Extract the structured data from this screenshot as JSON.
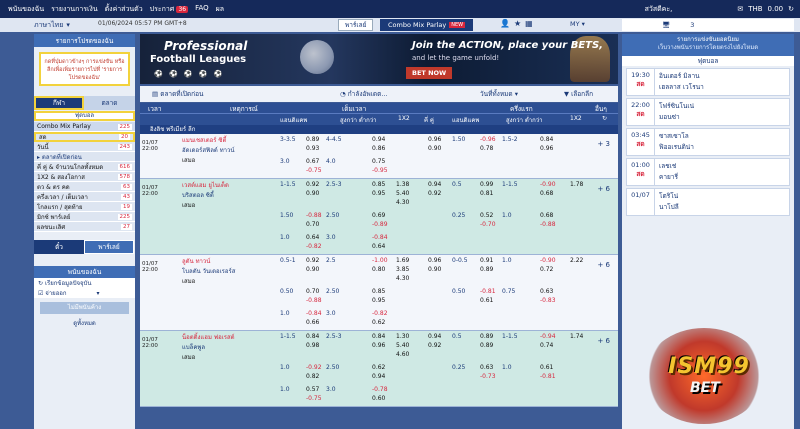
{
  "topbar": {
    "menu": [
      "พนันของฉัน",
      "รายงานการเงิน",
      "ตั้งค่าส่วนตัว",
      "ประกาศ",
      "FAQ",
      "ผล"
    ],
    "notice_count": "36",
    "greeting": "สวัสดีคะ,",
    "currency": "THB",
    "balance": "0.00"
  },
  "secondbar": {
    "language": "ภาษาไทย",
    "datetime": "01/06/2024 05:57 PM GMT+8",
    "tab_party": "พาร์เลย์",
    "tab_combo": "Combo Mix Parlay",
    "tab_new": "NEW",
    "my_label": "MY",
    "right_count": "3"
  },
  "left": {
    "header": "รายการโปรดของฉัน",
    "favorites_hint": "กดที่ปุ่มดาวข้างๆ การแข่งขัน หรือลีกเพื่อเพิ่มรายการไปที่ 'รายการโปรดของฉัน'",
    "tab_sports": "กีฬา",
    "tab_market": "ตลาด",
    "sub_soccer": "ฟุตบอล",
    "items": [
      {
        "label": "Combo Mix Parlay",
        "count": "225"
      },
      {
        "label": "สด",
        "count": "20"
      },
      {
        "label": "วันนี้",
        "count": "243"
      },
      {
        "label": "▸ ตลาดที่เปิดก่อน",
        "count": ""
      },
      {
        "label": "คี่ คู่ & จำนวนโกลทั้งหมด",
        "count": "616"
      },
      {
        "label": "1X2 & สองโอกาส",
        "count": "578"
      },
      {
        "label": "ตว & ตร คด",
        "count": "63"
      },
      {
        "label": "ครึ่งเวลา / เต็มเวลา",
        "count": "43"
      },
      {
        "label": "โกลแรก / สุดท้าย",
        "count": "19"
      },
      {
        "label": "มิกซ์ พาร์เลย์",
        "count": "225"
      },
      {
        "label": "ผลขนะเลิศ",
        "count": "27"
      }
    ],
    "btab_ticket": "ตั๋ว",
    "btab_parlay": "พาร์เลย์",
    "my_bets": "พนันของฉัน",
    "refresh": "เรียกข้อมูลปัจจุบัน",
    "pending": "รอการยืนยัน",
    "rejected": "จ่ายออก",
    "no_bets": "ไม่มีพนันค้าง",
    "view_all": "ดูทั้งหมด"
  },
  "banner": {
    "title1": "Professional",
    "title2": "Football Leagues",
    "title3": "Join the ACTION, place your BETS,",
    "title4": "and let the game unfold!",
    "cta": "BET NOW"
  },
  "filter": {
    "pre_market": "ตลาดที่เปิดก่อน",
    "updating": "กำลังอัพเดต...",
    "all_days": "วันที่ทั้งหมด",
    "select_league": "เลือกลีก"
  },
  "grid": {
    "h_time": "เวลา",
    "h_event": "เหตุการณ์",
    "h_full": "เต็มเวลา",
    "h_half": "ครึ่งแรก",
    "h_more": "อื่นๆ",
    "h_hdp": "แฮนดิแคพ",
    "h_ou": "สูงกว่า ต่ำกว่า",
    "h_1x2": "1X2",
    "h_oe": "คี่ คู่",
    "h_hdp2": "แฮนดิแคพ",
    "h_ou2": "สูงกว่า ต่ำกว่า",
    "h_1x22": "1X2",
    "league": "อิงลิช พรีเมียร์ ลีก"
  },
  "matches": [
    {
      "date": "01/07",
      "time": "22:00",
      "home": "แมนเชสเตอร์ ซิตี้",
      "away": "ฮัดเดอร์สฟิลด์ ทาวน์",
      "draw": "เสมอ",
      "more": "+ 3",
      "style": "white",
      "rows": [
        {
          "h": "3-3.5",
          "hv1": "0.89",
          "hv2": "0.93",
          "ou": "4-4.5",
          "ov1": "0.94",
          "ov2": "0.86",
          "x1": "",
          "x2": "",
          "x3": "",
          "oe1": "0.96",
          "oe2": "0.90",
          "hh": "1.50",
          "hh1": "-0.96",
          "hh2": "0.78",
          "ho": "1.5-2",
          "ho1": "0.84",
          "ho2": "0.96",
          "hx": ""
        },
        {
          "h": "3.0",
          "hv1": "0.67",
          "hv2": "-0.75",
          "ou": "4.0",
          "ov1": "0.75",
          "ov2": "-0.95",
          "x1": "",
          "x2": "",
          "x3": "",
          "oe1": "",
          "oe2": "",
          "hh": "",
          "hh1": "",
          "hh2": "",
          "ho": "",
          "ho1": "",
          "ho2": "",
          "hx": ""
        }
      ]
    },
    {
      "date": "01/07",
      "time": "22:00",
      "home": "เวสต์แฮม ยูไนเต็ด",
      "away": "บริสตอล ซิตี้",
      "draw": "เสมอ",
      "more": "+ 6",
      "style": "green",
      "rows": [
        {
          "h": "1-1.5",
          "hv1": "0.92",
          "hv2": "0.90",
          "ou": "2.5-3",
          "ov1": "0.85",
          "ov2": "0.95",
          "x1": "1.38",
          "x2": "5.40",
          "x3": "4.30",
          "oe1": "0.94",
          "oe2": "0.92",
          "hh": "0.5",
          "hh1": "0.99",
          "hh2": "0.81",
          "ho": "1-1.5",
          "ho1": "-0.90",
          "ho2": "0.68",
          "hx": "1.78"
        },
        {
          "h": "1.50",
          "hv1": "-0.88",
          "hv2": "0.70",
          "ou": "2.50",
          "ov1": "0.69",
          "ov2": "-0.89",
          "x1": "",
          "x2": "",
          "x3": "",
          "oe1": "",
          "oe2": "",
          "hh": "0.25",
          "hh1": "0.52",
          "hh2": "-0.70",
          "ho": "1.0",
          "ho1": "0.68",
          "ho2": "-0.88",
          "hx": ""
        },
        {
          "h": "1.0",
          "hv1": "0.64",
          "hv2": "-0.82",
          "ou": "3.0",
          "ov1": "-0.84",
          "ov2": "0.64",
          "x1": "",
          "x2": "",
          "x3": "",
          "oe1": "",
          "oe2": "",
          "hh": "",
          "hh1": "",
          "hh2": "",
          "ho": "",
          "ho1": "",
          "ho2": "",
          "hx": ""
        }
      ]
    },
    {
      "date": "01/07",
      "time": "22:00",
      "home": "ลูตัน ทาวน์",
      "away": "โบลตัน วันเดอเรอร์ส",
      "draw": "เสมอ",
      "more": "+ 6",
      "style": "white",
      "rows": [
        {
          "h": "0.5-1",
          "hv1": "0.92",
          "hv2": "0.90",
          "ou": "2.5",
          "ov1": "-1.00",
          "ov2": "0.80",
          "x1": "1.69",
          "x2": "3.85",
          "x3": "4.30",
          "oe1": "0.96",
          "oe2": "0.90",
          "hh": "0-0.5",
          "hh1": "0.91",
          "hh2": "0.89",
          "ho": "1.0",
          "ho1": "-0.90",
          "ho2": "0.72",
          "hx": "2.22"
        },
        {
          "h": "0.50",
          "hv1": "0.70",
          "hv2": "-0.88",
          "ou": "2.50",
          "ov1": "0.85",
          "ov2": "0.95",
          "x1": "",
          "x2": "",
          "x3": "",
          "oe1": "",
          "oe2": "",
          "hh": "0.50",
          "hh1": "-0.81",
          "hh2": "0.61",
          "ho": "0.75",
          "ho1": "0.63",
          "ho2": "-0.83",
          "hx": ""
        },
        {
          "h": "1.0",
          "hv1": "-0.84",
          "hv2": "0.66",
          "ou": "3.0",
          "ov1": "-0.82",
          "ov2": "0.62",
          "x1": "",
          "x2": "",
          "x3": "",
          "oe1": "",
          "oe2": "",
          "hh": "",
          "hh1": "",
          "hh2": "",
          "ho": "",
          "ho1": "",
          "ho2": "",
          "hx": ""
        }
      ]
    },
    {
      "date": "01/07",
      "time": "22:00",
      "home": "น็อตติ้งแฮม ฟอเรสต์",
      "away": "แบล็คพูล",
      "draw": "เสมอ",
      "more": "+ 6",
      "style": "green",
      "rows": [
        {
          "h": "1-1.5",
          "hv1": "0.84",
          "hv2": "0.98",
          "ou": "2.5-3",
          "ov1": "0.84",
          "ov2": "0.96",
          "x1": "1.30",
          "x2": "5.40",
          "x3": "4.60",
          "oe1": "0.94",
          "oe2": "0.92",
          "hh": "0.5",
          "hh1": "0.89",
          "hh2": "0.89",
          "ho": "1-1.5",
          "ho1": "-0.94",
          "ho2": "0.74",
          "hx": "1.74"
        },
        {
          "h": "1.0",
          "hv1": "-0.92",
          "hv2": "0.82",
          "ou": "2.50",
          "ov1": "0.62",
          "ov2": "0.94",
          "x1": "",
          "x2": "",
          "x3": "",
          "oe1": "",
          "oe2": "",
          "hh": "0.25",
          "hh1": "0.63",
          "hh2": "-0.73",
          "ho": "1.0",
          "ho1": "0.61",
          "ho2": "-0.81",
          "hx": ""
        },
        {
          "h": "1.0",
          "hv1": "0.57",
          "hv2": "-0.75",
          "ou": "3.0",
          "ov1": "-0.78",
          "ov2": "0.60",
          "x1": "",
          "x2": "",
          "x3": "",
          "oe1": "",
          "oe2": "",
          "hh": "",
          "hh1": "",
          "hh2": "",
          "ho": "",
          "ho1": "",
          "ho2": "",
          "hx": ""
        }
      ]
    }
  ],
  "right": {
    "header1": "รายการแข่งขันยอดนิยม",
    "header2": "เว็บวางพนันรายการโดยตรงไปยังโหมด",
    "section": "ฟุตบอล",
    "items": [
      {
        "time": "19:30",
        "status": "สด",
        "home": "อินเตอร์ มิลาน",
        "away": "เฮลลาส เวโรนา"
      },
      {
        "time": "22:00",
        "status": "สด",
        "home": "โฟร์ซินโนเน่",
        "away": "มอนซ่า"
      },
      {
        "time": "03:45",
        "status": "สด",
        "home": "ซาสเซาโล",
        "away": "ฟิออเรนติน่า"
      },
      {
        "time": "01:00",
        "status": "สด",
        "home": "เลชเช่",
        "away": "คายารี่"
      },
      {
        "time": "01/07",
        "status": "",
        "home": "โตริโน่",
        "away": "นาโปลี"
      }
    ]
  },
  "logo": {
    "name": "ISM99",
    "sub": "BET"
  }
}
